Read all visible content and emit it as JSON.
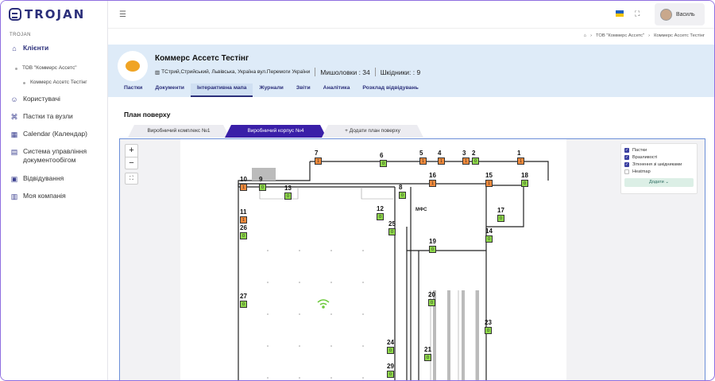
{
  "app": {
    "logo_text": "TROJAN",
    "section_label": "TROJAN"
  },
  "sidebar": {
    "items": [
      {
        "label": "Клієнти",
        "icon": "clients-icon"
      },
      {
        "label": "Користувачі",
        "icon": "user-icon"
      },
      {
        "label": "Пастки та вузли",
        "icon": "trap-icon"
      },
      {
        "label": "Calendar (Календар)",
        "icon": "calendar-icon"
      },
      {
        "label": "Система управління документообігом",
        "icon": "document-icon"
      },
      {
        "label": "Відвідування",
        "icon": "visits-icon"
      },
      {
        "label": "Моя компанія",
        "icon": "company-icon"
      }
    ],
    "sub_company": "ТОВ \"Коммерс Ассетс\"",
    "sub_subject": "Коммерс Ассетс Тестінг"
  },
  "header": {
    "user_name": "Василь",
    "colors": {
      "flag_blue": "#1f5fbf",
      "flag_yellow": "#f5c400"
    }
  },
  "breadcrumb": {
    "home_icon": "home-icon",
    "level1": "ТОВ \"Коммерс Ассетс\"",
    "level2": "Коммерс Ассетс Тестінг"
  },
  "client": {
    "name": "Коммерс Ассетс Тестінг",
    "address": "ТСтрий,Стрийський, Львівська, Україна вул.Перемоги України",
    "mice_traps": "Мишоловки : 34",
    "pest_traps": "Шкідники: : 9",
    "tabs": [
      "Пастки",
      "Документи",
      "Інтерактивна мапа",
      "Журнали",
      "Звіти",
      "Аналітика",
      "Розклад відвідувань"
    ],
    "active_tab": "Інтерактивна мапа"
  },
  "floor_plan": {
    "title": "План поверху",
    "tabs": [
      "Виробничий комплекс №1",
      "Виробничий корпус №4",
      "+ Додати план поверху"
    ],
    "active_tab": "Виробничий корпус №4",
    "zoom_in": "+",
    "zoom_out": "−",
    "legend": {
      "items": [
        {
          "label": "Пастки",
          "checked": true
        },
        {
          "label": "Вразливості",
          "checked": true
        },
        {
          "label": "Зіткнення зі шкідниками",
          "checked": true
        },
        {
          "label": "Heatmap",
          "checked": false
        }
      ],
      "add_label": "Додати"
    },
    "plan_label": "МФС",
    "markers": [
      {
        "id": "7",
        "value": "1",
        "status": "orange"
      },
      {
        "id": "6",
        "value": "0",
        "status": "green"
      },
      {
        "id": "5",
        "value": "1",
        "status": "orange"
      },
      {
        "id": "4",
        "value": "1",
        "status": "orange"
      },
      {
        "id": "3",
        "value": "1",
        "status": "orange"
      },
      {
        "id": "2",
        "value": "0",
        "status": "green"
      },
      {
        "id": "1",
        "value": "1",
        "status": "orange"
      },
      {
        "id": "10",
        "value": "1",
        "status": "orange"
      },
      {
        "id": "9",
        "value": "0",
        "status": "green"
      },
      {
        "id": "13",
        "value": "0",
        "status": "green"
      },
      {
        "id": "16",
        "value": "1",
        "status": "orange"
      },
      {
        "id": "15",
        "value": "1",
        "status": "orange"
      },
      {
        "id": "18",
        "value": "0",
        "status": "green"
      },
      {
        "id": "8",
        "value": "0",
        "status": "green"
      },
      {
        "id": "12",
        "value": "0",
        "status": "green"
      },
      {
        "id": "11",
        "value": "1",
        "status": "orange"
      },
      {
        "id": "17",
        "value": "0",
        "status": "green"
      },
      {
        "id": "26",
        "value": "0",
        "status": "green"
      },
      {
        "id": "25",
        "value": "0",
        "status": "green"
      },
      {
        "id": "14",
        "value": "0",
        "status": "green"
      },
      {
        "id": "19",
        "value": "0",
        "status": "green"
      },
      {
        "id": "27",
        "value": "0",
        "status": "green"
      },
      {
        "id": "20",
        "value": "0",
        "status": "green"
      },
      {
        "id": "23",
        "value": "0",
        "status": "green"
      },
      {
        "id": "24",
        "value": "0",
        "status": "green"
      },
      {
        "id": "21",
        "value": "0",
        "status": "green"
      },
      {
        "id": "29",
        "value": "0",
        "status": "green"
      }
    ]
  }
}
